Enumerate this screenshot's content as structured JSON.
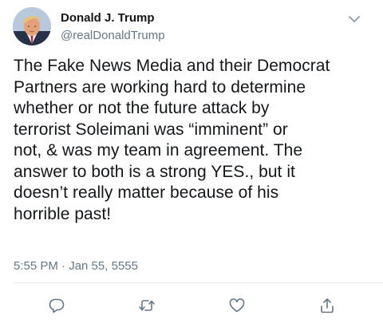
{
  "author": {
    "name": "Donald J. Trump",
    "handle": "@realDonaldTrump",
    "avatar_icon": "profile-photo-avatar"
  },
  "tweet": {
    "text": "The Fake News Media and their Democrat\nPartners are working hard to determine\nwhether or not the future attack by\nterrorist Soleimani was “imminent” or\nnot, & was my team in agreement. The\nanswer to both is a strong YES., but it\ndoesn’t really matter because of his\nhorrible past!",
    "timestamp": "5:55 PM · Jan 55, 5555"
  },
  "actions": [
    {
      "name": "reply",
      "icon": "reply-icon"
    },
    {
      "name": "retweet",
      "icon": "retweet-icon"
    },
    {
      "name": "like",
      "icon": "heart-icon"
    },
    {
      "name": "share",
      "icon": "share-icon"
    }
  ],
  "colors": {
    "text": "#14171a",
    "secondary": "#657786",
    "divider": "#e6ecf0"
  }
}
